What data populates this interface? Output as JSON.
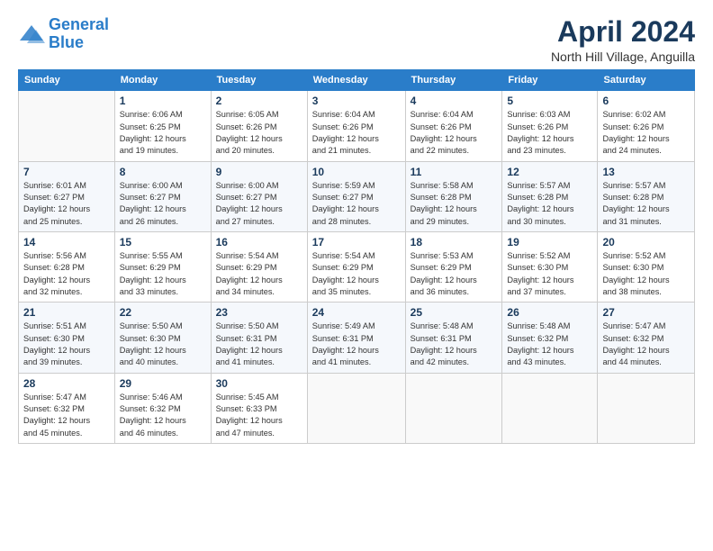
{
  "header": {
    "logo_line1": "General",
    "logo_line2": "Blue",
    "month_year": "April 2024",
    "location": "North Hill Village, Anguilla"
  },
  "weekdays": [
    "Sunday",
    "Monday",
    "Tuesday",
    "Wednesday",
    "Thursday",
    "Friday",
    "Saturday"
  ],
  "weeks": [
    [
      {
        "day": "",
        "info": ""
      },
      {
        "day": "1",
        "info": "Sunrise: 6:06 AM\nSunset: 6:25 PM\nDaylight: 12 hours\nand 19 minutes."
      },
      {
        "day": "2",
        "info": "Sunrise: 6:05 AM\nSunset: 6:26 PM\nDaylight: 12 hours\nand 20 minutes."
      },
      {
        "day": "3",
        "info": "Sunrise: 6:04 AM\nSunset: 6:26 PM\nDaylight: 12 hours\nand 21 minutes."
      },
      {
        "day": "4",
        "info": "Sunrise: 6:04 AM\nSunset: 6:26 PM\nDaylight: 12 hours\nand 22 minutes."
      },
      {
        "day": "5",
        "info": "Sunrise: 6:03 AM\nSunset: 6:26 PM\nDaylight: 12 hours\nand 23 minutes."
      },
      {
        "day": "6",
        "info": "Sunrise: 6:02 AM\nSunset: 6:26 PM\nDaylight: 12 hours\nand 24 minutes."
      }
    ],
    [
      {
        "day": "7",
        "info": "Sunrise: 6:01 AM\nSunset: 6:27 PM\nDaylight: 12 hours\nand 25 minutes."
      },
      {
        "day": "8",
        "info": "Sunrise: 6:00 AM\nSunset: 6:27 PM\nDaylight: 12 hours\nand 26 minutes."
      },
      {
        "day": "9",
        "info": "Sunrise: 6:00 AM\nSunset: 6:27 PM\nDaylight: 12 hours\nand 27 minutes."
      },
      {
        "day": "10",
        "info": "Sunrise: 5:59 AM\nSunset: 6:27 PM\nDaylight: 12 hours\nand 28 minutes."
      },
      {
        "day": "11",
        "info": "Sunrise: 5:58 AM\nSunset: 6:28 PM\nDaylight: 12 hours\nand 29 minutes."
      },
      {
        "day": "12",
        "info": "Sunrise: 5:57 AM\nSunset: 6:28 PM\nDaylight: 12 hours\nand 30 minutes."
      },
      {
        "day": "13",
        "info": "Sunrise: 5:57 AM\nSunset: 6:28 PM\nDaylight: 12 hours\nand 31 minutes."
      }
    ],
    [
      {
        "day": "14",
        "info": "Sunrise: 5:56 AM\nSunset: 6:28 PM\nDaylight: 12 hours\nand 32 minutes."
      },
      {
        "day": "15",
        "info": "Sunrise: 5:55 AM\nSunset: 6:29 PM\nDaylight: 12 hours\nand 33 minutes."
      },
      {
        "day": "16",
        "info": "Sunrise: 5:54 AM\nSunset: 6:29 PM\nDaylight: 12 hours\nand 34 minutes."
      },
      {
        "day": "17",
        "info": "Sunrise: 5:54 AM\nSunset: 6:29 PM\nDaylight: 12 hours\nand 35 minutes."
      },
      {
        "day": "18",
        "info": "Sunrise: 5:53 AM\nSunset: 6:29 PM\nDaylight: 12 hours\nand 36 minutes."
      },
      {
        "day": "19",
        "info": "Sunrise: 5:52 AM\nSunset: 6:30 PM\nDaylight: 12 hours\nand 37 minutes."
      },
      {
        "day": "20",
        "info": "Sunrise: 5:52 AM\nSunset: 6:30 PM\nDaylight: 12 hours\nand 38 minutes."
      }
    ],
    [
      {
        "day": "21",
        "info": "Sunrise: 5:51 AM\nSunset: 6:30 PM\nDaylight: 12 hours\nand 39 minutes."
      },
      {
        "day": "22",
        "info": "Sunrise: 5:50 AM\nSunset: 6:30 PM\nDaylight: 12 hours\nand 40 minutes."
      },
      {
        "day": "23",
        "info": "Sunrise: 5:50 AM\nSunset: 6:31 PM\nDaylight: 12 hours\nand 41 minutes."
      },
      {
        "day": "24",
        "info": "Sunrise: 5:49 AM\nSunset: 6:31 PM\nDaylight: 12 hours\nand 41 minutes."
      },
      {
        "day": "25",
        "info": "Sunrise: 5:48 AM\nSunset: 6:31 PM\nDaylight: 12 hours\nand 42 minutes."
      },
      {
        "day": "26",
        "info": "Sunrise: 5:48 AM\nSunset: 6:32 PM\nDaylight: 12 hours\nand 43 minutes."
      },
      {
        "day": "27",
        "info": "Sunrise: 5:47 AM\nSunset: 6:32 PM\nDaylight: 12 hours\nand 44 minutes."
      }
    ],
    [
      {
        "day": "28",
        "info": "Sunrise: 5:47 AM\nSunset: 6:32 PM\nDaylight: 12 hours\nand 45 minutes."
      },
      {
        "day": "29",
        "info": "Sunrise: 5:46 AM\nSunset: 6:32 PM\nDaylight: 12 hours\nand 46 minutes."
      },
      {
        "day": "30",
        "info": "Sunrise: 5:45 AM\nSunset: 6:33 PM\nDaylight: 12 hours\nand 47 minutes."
      },
      {
        "day": "",
        "info": ""
      },
      {
        "day": "",
        "info": ""
      },
      {
        "day": "",
        "info": ""
      },
      {
        "day": "",
        "info": ""
      }
    ]
  ]
}
